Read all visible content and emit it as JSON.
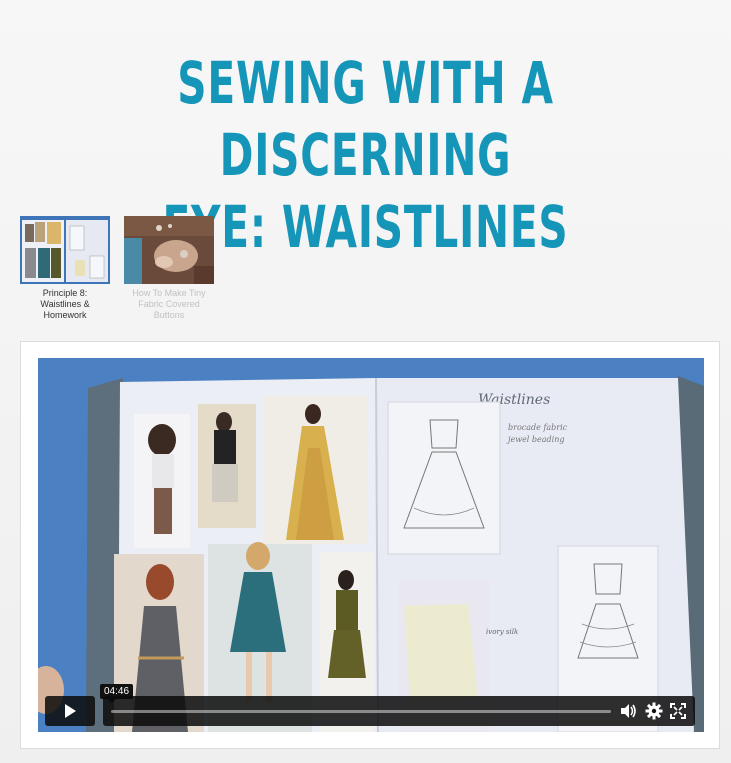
{
  "page": {
    "title_line1": "SEWING WITH A DISCERNING",
    "title_line2": "EYE: WAISTLINES"
  },
  "playlist": [
    {
      "caption": "Principle 8: Waistlines & Homework",
      "active": true
    },
    {
      "caption": "How To Make Tiny Fabric Covered Buttons",
      "active": false
    }
  ],
  "video": {
    "notebook_heading": "Waistlines",
    "time_display": "04:46",
    "progress": 0,
    "icons": [
      "play-icon",
      "volume-icon",
      "settings-icon",
      "fullscreen-icon"
    ]
  },
  "colors": {
    "title": "#1596b8",
    "video_background": "#4a7ec0",
    "control_bar": "#0a0a0a"
  }
}
